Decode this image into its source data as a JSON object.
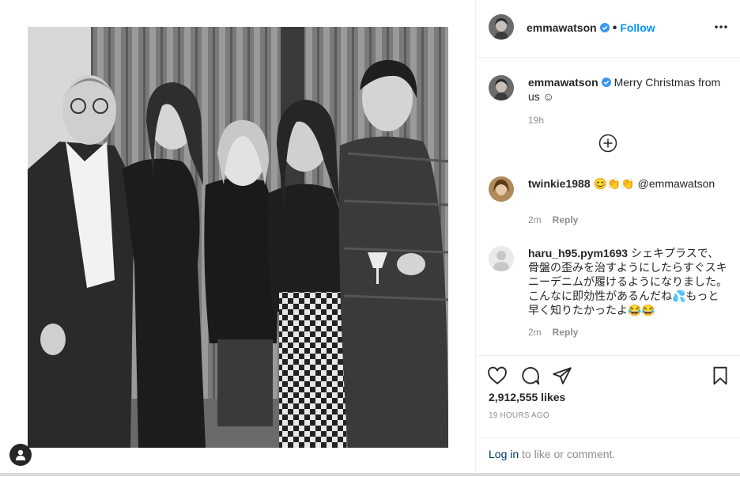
{
  "post": {
    "author": "emmawatson",
    "follow_label": "Follow",
    "dot": "•"
  },
  "caption": {
    "username": "emmawatson",
    "text": "Merry Christmas from us ☺",
    "age": "19h"
  },
  "comments": [
    {
      "username": "twinkie1988",
      "text": "😊👏👏 @emmawatson",
      "age": "2m",
      "reply_label": "Reply"
    },
    {
      "username": "haru_h95.pym1693",
      "text": "シェキプラスで、骨盤の歪みを治すようにしたらすぐスキニーデニムが履けるようになりました。こんなに即効性があるんだね💦もっと早く知りたかったよ😂😂",
      "age": "2m",
      "reply_label": "Reply"
    }
  ],
  "stats": {
    "likes": "2,912,555 likes",
    "posted": "19 HOURS AGO"
  },
  "login": {
    "link": "Log in",
    "rest": " to like or comment."
  },
  "icons": {
    "verified": "verified-badge-icon",
    "more": "more-options-icon",
    "load_more": "plus-circle-icon",
    "like": "heart-icon",
    "comment": "comment-bubble-icon",
    "share": "paper-plane-icon",
    "save": "bookmark-icon",
    "tag": "user-tag-icon"
  },
  "colors": {
    "accent": "#0095f6",
    "text": "#262626",
    "muted": "#8e8e8e",
    "verified": "#3897f0"
  }
}
